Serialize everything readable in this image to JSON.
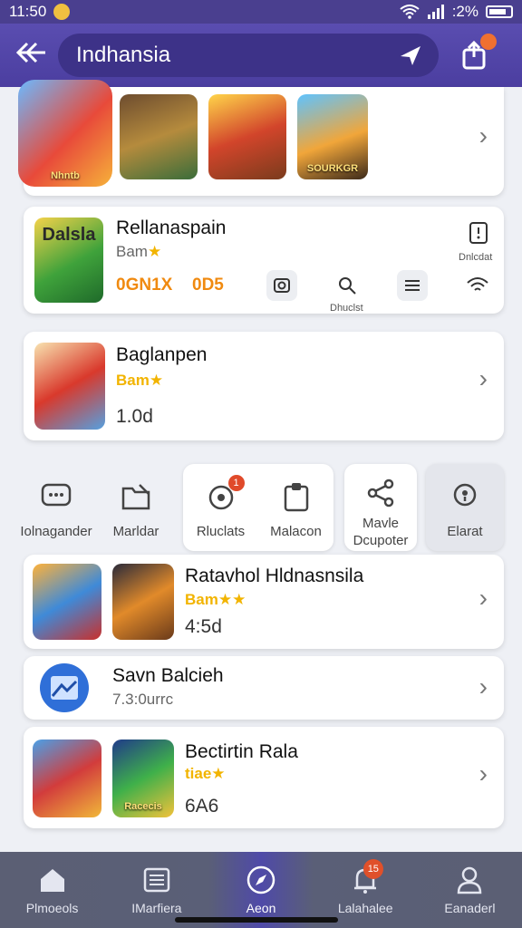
{
  "status_bar": {
    "time": "11:50",
    "battery": ":2%"
  },
  "header": {
    "title": "Indhansia"
  },
  "notifications_badge": "",
  "featured": {
    "items": [
      {
        "caption": "Nhntb"
      },
      {
        "caption": ""
      },
      {
        "caption": ""
      },
      {
        "caption": "SOURKGR"
      }
    ]
  },
  "app_row_1": {
    "title": "Rellanaspain",
    "rating_text": "Bam",
    "stars": "★",
    "stat_1": "0GN1X",
    "stat_2": "0D5",
    "top_right_label": "Dnlcdat",
    "icon_label": "Dhuclst",
    "thumb_caption": "Dalsla"
  },
  "app_row_2": {
    "title": "Baglanpen",
    "rating_text": "Bam",
    "stars": "★",
    "size": "1.0d"
  },
  "tiles": [
    {
      "label": "Iolnagander"
    },
    {
      "label": "Marldar"
    },
    {
      "label": "Rluclats",
      "badge": "1"
    },
    {
      "label": "Malacon"
    },
    {
      "label": "Mavle Dcupoter"
    },
    {
      "label": "Elarat"
    }
  ],
  "app_row_3": {
    "title": "Ratavhol Hldnasnsila",
    "rating_text": "Bam",
    "stars": "★★",
    "size": "4:5d"
  },
  "app_row_4": {
    "title": "Savn Balcieh",
    "subtitle": "7.3:0urrc"
  },
  "app_row_5": {
    "title": "Bectirtin Rala",
    "rating_text": "tiae",
    "stars": "★",
    "size": "6A6",
    "thumb_caption": "Racecis"
  },
  "bottom_nav": [
    {
      "label": "Plmoeols"
    },
    {
      "label": "IMarfiera"
    },
    {
      "label": "Aeon"
    },
    {
      "label": "Lalahalee",
      "badge": "15"
    },
    {
      "label": "Eanaderl"
    }
  ]
}
